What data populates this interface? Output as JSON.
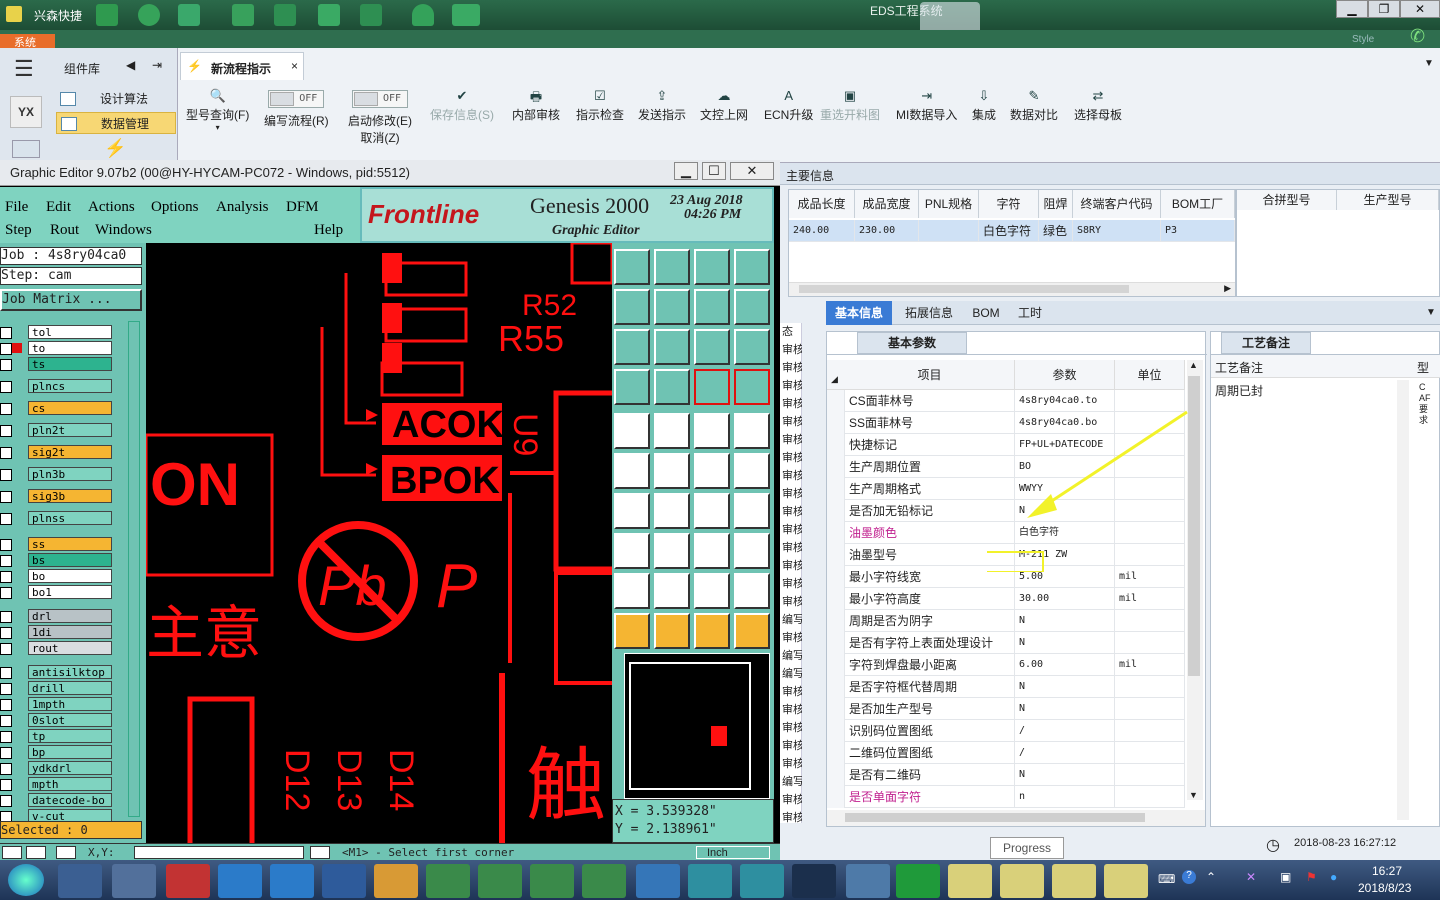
{
  "topbar": {
    "app": "兴森快捷",
    "title": "EDS工程系统",
    "style": "Style"
  },
  "system_tab": "系统",
  "leftnav": {
    "title": "组件库",
    "items": [
      "设计算法",
      "数据管理"
    ],
    "badge": "YX"
  },
  "doc_tab": {
    "label": "新流程指示",
    "close": "×"
  },
  "ribbon": [
    {
      "label": "型号查询(F)",
      "icon": "🔍",
      "enabled": true
    },
    {
      "label": "编写流程(R)",
      "toggle": "OFF",
      "enabled": true
    },
    {
      "label": "启动修改(E)",
      "sub": "取消(Z)",
      "toggle": "OFF",
      "enabled": true
    },
    {
      "label": "保存信息(S)",
      "icon": "✔",
      "enabled": false
    },
    {
      "label": "内部审核",
      "icon": "🖶",
      "enabled": true
    },
    {
      "label": "指示检查",
      "icon": "☑",
      "enabled": true
    },
    {
      "label": "发送指示",
      "icon": "⇪",
      "enabled": true
    },
    {
      "label": "文控上网",
      "icon": "☁",
      "enabled": true
    },
    {
      "label": "ECN升级",
      "icon": "A",
      "enabled": true
    },
    {
      "label": "重选开料图",
      "icon": "▣",
      "enabled": false
    },
    {
      "label": "MI数据导入",
      "icon": "⇥",
      "enabled": true
    },
    {
      "label": "集成",
      "icon": "⇩",
      "enabled": true
    },
    {
      "label": "数据对比",
      "icon": "✎",
      "enabled": true
    },
    {
      "label": "选择母板",
      "icon": "⇄",
      "enabled": true
    }
  ],
  "main_info": {
    "section": "主要信息",
    "headers": [
      "成品长度",
      "成品宽度",
      "PNL规格",
      "字符",
      "阻焊",
      "终端客户代码",
      "BOM工厂"
    ],
    "row": [
      "240.00",
      "230.00",
      "",
      "白色字符",
      "绿色",
      "S8RY",
      "P3"
    ],
    "headers2": [
      "合拼型号",
      "生产型号"
    ]
  },
  "tabs": [
    "基本信息",
    "拓展信息",
    "BOM",
    "工时"
  ],
  "basic": {
    "subtab": "基本参数",
    "headers": [
      "项目",
      "参数",
      "单位"
    ],
    "rows": [
      {
        "item": "CS面菲林号",
        "value": "4s8ry04ca0.to",
        "unit": "",
        "red": false
      },
      {
        "item": "SS面菲林号",
        "value": "4s8ry04ca0.bo",
        "unit": "",
        "red": false
      },
      {
        "item": "快捷标记",
        "value": "FP+UL+DATECODE",
        "unit": "",
        "red": false
      },
      {
        "item": "生产周期位置",
        "value": "BO",
        "unit": "",
        "red": false
      },
      {
        "item": "生产周期格式",
        "value": "WWYY",
        "unit": "",
        "red": false
      },
      {
        "item": "是否加无铅标记",
        "value": "N",
        "unit": "",
        "red": false
      },
      {
        "item": "油墨颜色",
        "value": "白色字符",
        "unit": "",
        "red": true
      },
      {
        "item": "油墨型号",
        "value": "M-211 ZW",
        "unit": "",
        "red": false
      },
      {
        "item": "最小字符线宽",
        "value": "5.00",
        "unit": "mil",
        "red": false
      },
      {
        "item": "最小字符高度",
        "value": "30.00",
        "unit": "mil",
        "red": false
      },
      {
        "item": "周期是否为阴字",
        "value": "N",
        "unit": "",
        "red": false
      },
      {
        "item": "是否有字符上表面处理设计",
        "value": "N",
        "unit": "",
        "red": false
      },
      {
        "item": "字符到焊盘最小距离",
        "value": "6.00",
        "unit": "mil",
        "red": false
      },
      {
        "item": "是否字符框代替周期",
        "value": "N",
        "unit": "",
        "red": false
      },
      {
        "item": "是否加生产型号",
        "value": "N",
        "unit": "",
        "red": false
      },
      {
        "item": "识别码位置图纸",
        "value": "/",
        "unit": "",
        "red": false
      },
      {
        "item": "二维码位置图纸",
        "value": "/",
        "unit": "",
        "red": false
      },
      {
        "item": "是否有二维码",
        "value": "N",
        "unit": "",
        "red": false
      },
      {
        "item": "是否单面字符",
        "value": "n",
        "unit": "",
        "red": true
      }
    ]
  },
  "craft": {
    "tab": "工艺备注",
    "header": "工艺备注",
    "type_header": "型",
    "note": "周期已封",
    "side": "CAF要求"
  },
  "left_stub": [
    "态",
    "审核",
    "审核",
    "审核",
    "审核",
    "审核",
    "审核",
    "审核",
    "审核",
    "审核",
    "审核",
    "审核",
    "审核",
    "审核",
    "审核",
    "审核",
    "编写",
    "审核",
    "编写",
    "编写",
    "审核",
    "审核",
    "审核",
    "审核",
    "审核",
    "编写",
    "审核",
    "审核"
  ],
  "status": {
    "datetime": "2018-08-23 16:27:12",
    "progress": "Progress"
  },
  "ge": {
    "title": "Graphic Editor 9.07b2 (00@HY-HYCAM-PC072 - Windows, pid:5512)",
    "menu1": [
      "File",
      "Edit",
      "Actions",
      "Options",
      "Analysis",
      "DFM"
    ],
    "menu2": [
      "Step",
      "Rout",
      "Windows",
      "Help"
    ],
    "brand": "Frontline",
    "product": "Genesis 2000",
    "subtitle": "Graphic Editor",
    "date": "23 Aug 2018",
    "time": "04:26 PM",
    "job": "Job : 4s8ry04ca0",
    "step": "Step: cam",
    "matrix": "Job Matrix ...",
    "layers": [
      {
        "n": "tol",
        "c": "#ffffff"
      },
      {
        "n": "to",
        "c": "#ffffff"
      },
      {
        "n": "ts",
        "c": "#2db38f"
      },
      {
        "n": "plncs",
        "c": "#7fd3c0"
      },
      {
        "n": "cs",
        "c": "#f5b532"
      },
      {
        "n": "pln2t",
        "c": "#7fd3c0"
      },
      {
        "n": "sig2t",
        "c": "#f5b532"
      },
      {
        "n": "pln3b",
        "c": "#7fd3c0"
      },
      {
        "n": "sig3b",
        "c": "#f5b532"
      },
      {
        "n": "plnss",
        "c": "#7fd3c0"
      },
      {
        "n": "ss",
        "c": "#f5b532"
      },
      {
        "n": "bs",
        "c": "#2db38f"
      },
      {
        "n": "bo",
        "c": "#ffffff"
      },
      {
        "n": "bo1",
        "c": "#ffffff"
      },
      {
        "n": "drl",
        "c": "#b8c2c6"
      },
      {
        "n": "1di",
        "c": "#b8c2c6"
      },
      {
        "n": "rout",
        "c": "#d9dde0"
      },
      {
        "n": "antisilktop",
        "c": "#7fd3c0"
      },
      {
        "n": "drill",
        "c": "#7fd3c0"
      },
      {
        "n": "1mpth",
        "c": "#7fd3c0"
      },
      {
        "n": "0slot",
        "c": "#7fd3c0"
      },
      {
        "n": "tp",
        "c": "#7fd3c0"
      },
      {
        "n": "bp",
        "c": "#7fd3c0"
      },
      {
        "n": "ydkdrl",
        "c": "#7fd3c0"
      },
      {
        "n": "mpth",
        "c": "#7fd3c0"
      },
      {
        "n": "datecode-bo",
        "c": "#7fd3c0"
      },
      {
        "n": "v-cut",
        "c": "#7fd3c0"
      }
    ],
    "selected": "Selected : 0",
    "coord_x": "X = 3.539328\"",
    "coord_y": "Y = 2.138961\"",
    "prompt": "<M1> - Select first corner",
    "unit": "Inch",
    "xy_label": "X,Y:",
    "canvas_text": {
      "r52": "R52",
      "r55": "R55",
      "acok": "ACOK",
      "bpok": "BPOK",
      "u9": "U9",
      "on": "ON",
      "pb": "Pb",
      "p": "P",
      "zhuyi": "主意",
      "chu": "触",
      "d12": "D12",
      "d13": "D13",
      "d14": "D14"
    }
  },
  "clock": {
    "time": "16:27",
    "date": "2018/8/23"
  }
}
